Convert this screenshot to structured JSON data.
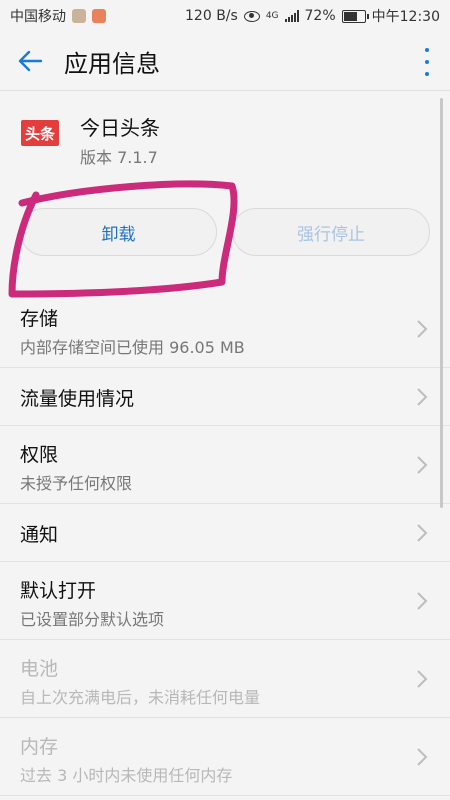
{
  "status_bar": {
    "carrier": "中国移动",
    "speed": "120 B/s",
    "network": "4G",
    "battery_percent": "72%",
    "battery_level": 0.72,
    "time": "中午12:30"
  },
  "header": {
    "title": "应用信息"
  },
  "app": {
    "icon_text": "头条",
    "name": "今日头条",
    "version": "版本 7.1.7"
  },
  "buttons": {
    "uninstall": "卸载",
    "force_stop": "强行停止"
  },
  "items": [
    {
      "title": "存储",
      "subtitle": "内部存储空间已使用 96.05 MB",
      "enabled": true
    },
    {
      "title": "流量使用情况",
      "subtitle": "",
      "enabled": true
    },
    {
      "title": "权限",
      "subtitle": "未授予任何权限",
      "enabled": true
    },
    {
      "title": "通知",
      "subtitle": "",
      "enabled": true
    },
    {
      "title": "默认打开",
      "subtitle": "已设置部分默认选项",
      "enabled": true
    },
    {
      "title": "电池",
      "subtitle": "自上次充满电后，未消耗任何电量",
      "enabled": false
    },
    {
      "title": "内存",
      "subtitle": "过去 3 小时内未使用任何内存",
      "enabled": false
    }
  ],
  "colors": {
    "accent": "#1a7bd6",
    "highlight": "#cc2a7a",
    "app_icon": "#e33d3d"
  }
}
